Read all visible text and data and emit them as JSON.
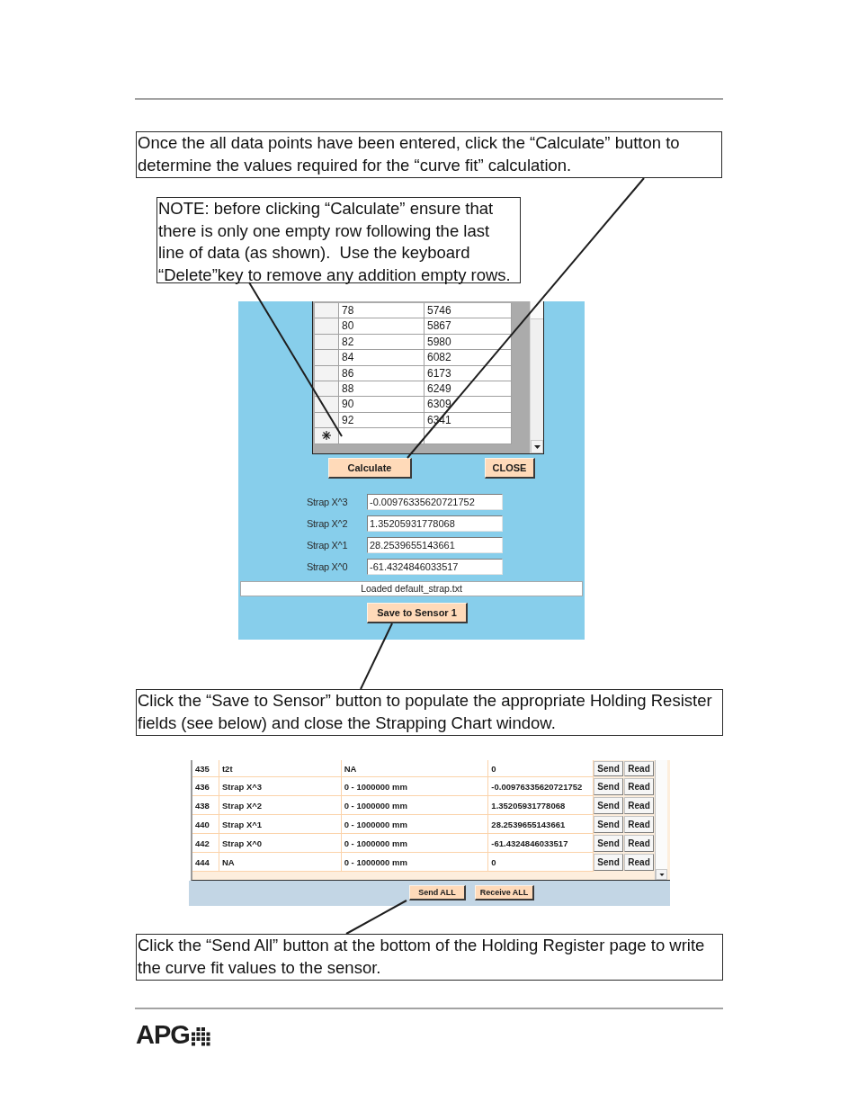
{
  "calculate_callout": {
    "text": "Once the all data points have been entered, click the “Calculate” button to determine the values required for the “curve fit” calculation."
  },
  "note_callout": {
    "text": "NOTE: before clicking “Calculate” ensure that there is only one empty row following the last line of data (as shown).  Use the keyboard “Delete”key to remove any addition empty rows."
  },
  "strapping_chart": {
    "rows": [
      {
        "column_1": "78",
        "column_2": "5746"
      },
      {
        "column_1": "80",
        "column_2": "5867"
      },
      {
        "column_1": "82",
        "column_2": "5980"
      },
      {
        "column_1": "84",
        "column_2": "6082"
      },
      {
        "column_1": "86",
        "column_2": "6173"
      },
      {
        "column_1": "88",
        "column_2": "6249"
      },
      {
        "column_1": "90",
        "column_2": "6309"
      },
      {
        "column_1": "92",
        "column_2": "6341"
      }
    ],
    "buttons": [
      {
        "label": "Calculate"
      },
      {
        "label": "CLOSE"
      }
    ],
    "coefficients": [
      {
        "label": "Strap X^3",
        "value": "-0.00976335620721752"
      },
      {
        "label": "Strap X^2",
        "value": "1.35205931778068"
      },
      {
        "label": "Strap X^1",
        "value": "28.2539655143661"
      },
      {
        "label": "Strap X^0",
        "value": "-61.4324846033517"
      }
    ],
    "status": "Loaded default_strap.txt",
    "save_button": "Save to Sensor 1"
  },
  "save_callout": {
    "text": "Click the “Save to Sensor” button to populate the appropriate Holding Resister fields (see below) and close the Strapping Chart window."
  },
  "holding_registers": {
    "rows": [
      {
        "column_1": "435",
        "column_2": "t2t",
        "column_3": "NA",
        "column_4": "0",
        "send": "Send",
        "read": "Read"
      },
      {
        "column_1": "436",
        "column_2": "Strap X^3",
        "column_3": "0 - 1000000 mm",
        "column_4": "-0.00976335620721752",
        "send": "Send",
        "read": "Read"
      },
      {
        "column_1": "438",
        "column_2": "Strap X^2",
        "column_3": "0 - 1000000 mm",
        "column_4": "1.35205931778068",
        "send": "Send",
        "read": "Read"
      },
      {
        "column_1": "440",
        "column_2": "Strap X^1",
        "column_3": "0 - 1000000 mm",
        "column_4": "28.2539655143661",
        "send": "Send",
        "read": "Read"
      },
      {
        "column_1": "442",
        "column_2": "Strap X^0",
        "column_3": "0 - 1000000 mm",
        "column_4": "-61.4324846033517",
        "send": "Send",
        "read": "Read"
      },
      {
        "column_1": "444",
        "column_2": "NA",
        "column_3": "0 - 1000000 mm",
        "column_4": "0",
        "send": "Send",
        "read": "Read"
      }
    ],
    "buttons": [
      {
        "label": "Send ALL"
      },
      {
        "label": "Receive ALL"
      }
    ]
  },
  "send_all_callout": {
    "text": "Click the “Send All” button at the bottom of the Holding Register page to write the curve fit values to the sensor."
  },
  "footer": {
    "logo": "APG"
  }
}
